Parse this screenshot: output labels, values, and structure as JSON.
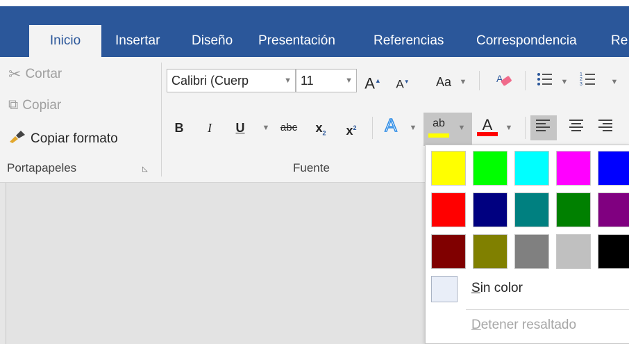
{
  "tabs": [
    {
      "label": "Inicio",
      "active": true
    },
    {
      "label": "Insertar"
    },
    {
      "label": "Diseño"
    },
    {
      "label": "Presentación"
    },
    {
      "label": "Referencias"
    },
    {
      "label": "Correspondencia"
    },
    {
      "label": "Re"
    }
  ],
  "clipboard": {
    "cut": "Cortar",
    "copy": "Copiar",
    "format_painter": "Copiar formato",
    "group_label": "Portapapeles"
  },
  "font": {
    "font_name": "Calibri (Cuerp",
    "font_size": "11",
    "group_label": "Fuente",
    "grow": "A",
    "shrink": "A",
    "change_case": "Aa",
    "bold": "B",
    "italic": "I",
    "underline": "U",
    "strikethrough": "abc",
    "subscript": "x",
    "subscript_mark": "2",
    "superscript": "x",
    "superscript_mark": "2",
    "text_effects": "A",
    "highlight": "ab",
    "font_color": "A"
  },
  "colors": {
    "accent": "#2b579a",
    "highlight_bar": "#ffff00",
    "font_color_bar": "#ff0000"
  },
  "highlight_menu": {
    "swatches": [
      [
        "#ffff00",
        "#00ff00",
        "#00ffff",
        "#ff00ff",
        "#0000ff"
      ],
      [
        "#ff0000",
        "#000080",
        "#008080",
        "#008000",
        "#800080"
      ],
      [
        "#800000",
        "#808000",
        "#808080",
        "#c0c0c0",
        "#000000"
      ]
    ],
    "no_color_first": "S",
    "no_color_rest": "in color",
    "stop_first": "D",
    "stop_rest": "etener resaltado"
  }
}
